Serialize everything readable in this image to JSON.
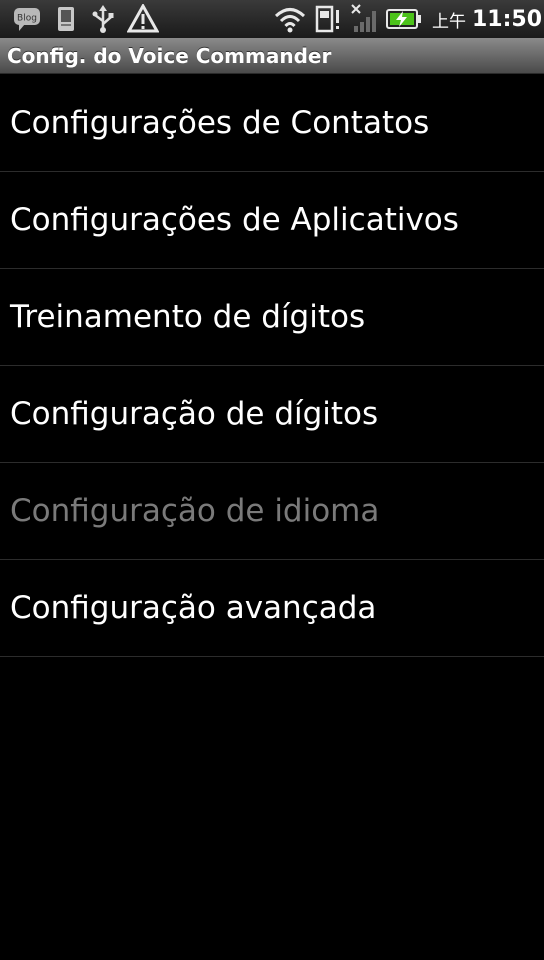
{
  "status_bar": {
    "icons": [
      "blog-icon",
      "sim-card-icon",
      "usb-icon",
      "warning-icon",
      "wifi-icon",
      "sd-card-alert-icon",
      "no-signal-icon",
      "battery-charging-icon"
    ],
    "blog_label": "Blog",
    "period": "上午",
    "time": "11:50"
  },
  "title_bar": {
    "title": "Config. do Voice Commander"
  },
  "menu": {
    "items": [
      {
        "label": "Configurações de Contatos",
        "enabled": true
      },
      {
        "label": "Configurações de Aplicativos",
        "enabled": true
      },
      {
        "label": "Treinamento de dígitos",
        "enabled": true
      },
      {
        "label": "Configuração de dígitos",
        "enabled": true
      },
      {
        "label": "Configuração de idioma",
        "enabled": false
      },
      {
        "label": "Configuração avançada",
        "enabled": true
      }
    ]
  },
  "colors": {
    "background": "#000000",
    "text": "#ffffff",
    "disabled_text": "#7a7a7a",
    "divider": "#2c2c2c",
    "battery_fill": "#4cc21a"
  }
}
